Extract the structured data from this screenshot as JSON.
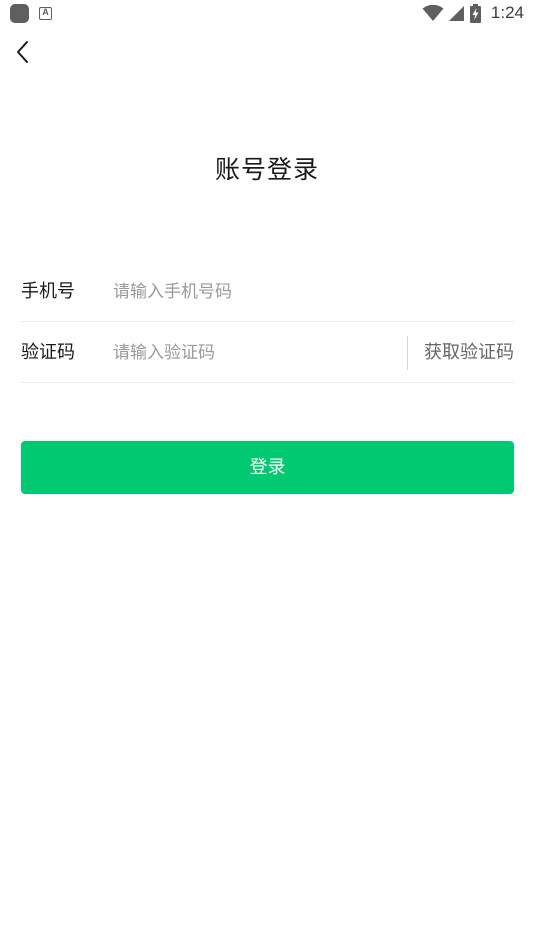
{
  "status_bar": {
    "time": "1:24",
    "icons": [
      "app-icon",
      "a-icon",
      "wifi-icon",
      "signal-icon",
      "battery-charging-icon"
    ]
  },
  "nav": {
    "back_icon": "chevron-left-icon"
  },
  "title": "账号登录",
  "form": {
    "phone": {
      "label": "手机号",
      "placeholder": "请输入手机号码",
      "value": ""
    },
    "code": {
      "label": "验证码",
      "placeholder": "请输入验证码",
      "value": "",
      "get_code_label": "获取验证码"
    }
  },
  "login_button": {
    "label": "登录",
    "color": "#00c972"
  }
}
